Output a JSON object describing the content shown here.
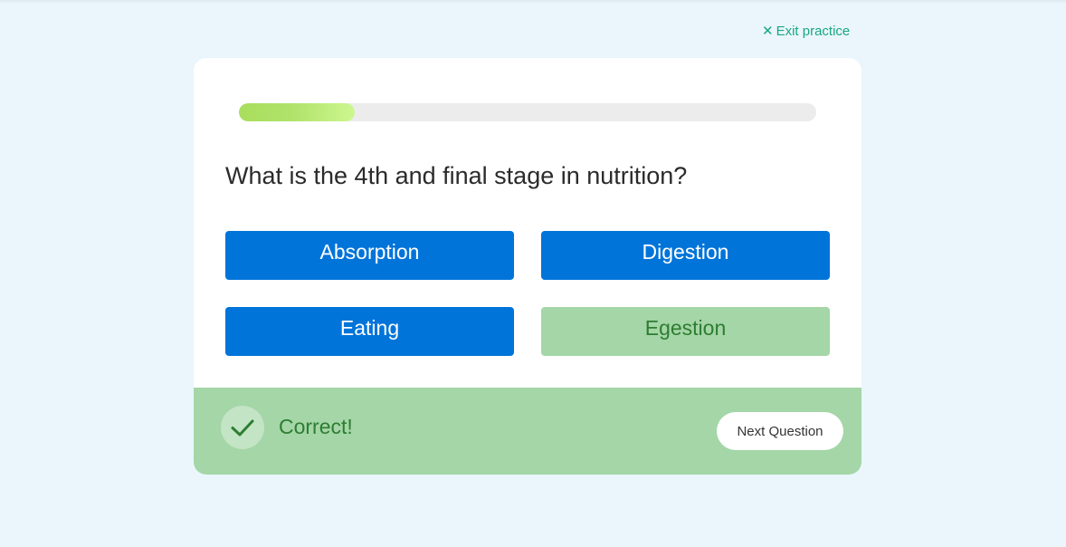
{
  "header": {
    "exit_icon": "close-icon",
    "exit_label": "Exit practice"
  },
  "progress": {
    "fraction": 0.2
  },
  "question": {
    "text": "What is the 4th and final stage in nutrition?"
  },
  "answers": [
    {
      "label": "Absorption",
      "state": "default"
    },
    {
      "label": "Digestion",
      "state": "default"
    },
    {
      "label": "Eating",
      "state": "default"
    },
    {
      "label": "Egestion",
      "state": "correct"
    }
  ],
  "feedback": {
    "icon": "checkmark-icon",
    "text": "Correct!",
    "next_button_label": "Next Question"
  },
  "colors": {
    "accent_link": "#1aa683",
    "answer_blue": "#0074d9",
    "correct_green_bg": "#a4d6a7",
    "correct_green_text": "#2e7d32",
    "progress_fill": "#b0e26a",
    "page_bg": "#eaf6fc"
  }
}
